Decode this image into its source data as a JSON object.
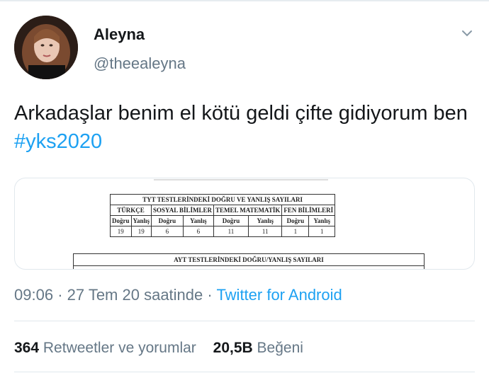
{
  "user": {
    "display_name": "Aleyna",
    "handle": "@theealeyna"
  },
  "tweet": {
    "text": "Arkadaşlar benim el kötü geldi çifte gidiyorum ben",
    "hashtag": "#yks2020"
  },
  "media": {
    "table1_title": "TYT TESTLERİNDEKİ DOĞRU VE YANLIŞ SAYILARI",
    "table1_sections": [
      "TÜRKÇE",
      "SOSYAL BİLİMLER",
      "TEMEL MATEMATİK",
      "FEN BİLİMLERİ"
    ],
    "table1_subheaders": [
      "Doğru",
      "Yanlış",
      "Doğru",
      "Yanlış",
      "Doğru",
      "Yanlış",
      "Doğru",
      "Yanlış"
    ],
    "table1_values": [
      "19",
      "19",
      "6",
      "6",
      "11",
      "11",
      "1",
      "1"
    ],
    "table2_title": "AYT TESTLERİNDEKİ DOĞRU/YANLIŞ SAYILARI"
  },
  "meta": {
    "time": "09:06",
    "separator": "·",
    "date": "27 Tem 20 saatinde",
    "separator2": "·",
    "source": "Twitter for Android"
  },
  "stats": {
    "retweets_count": "364",
    "retweets_label": "Retweetler ve yorumlar",
    "likes_count": "20,5B",
    "likes_label": "Beğeni"
  }
}
